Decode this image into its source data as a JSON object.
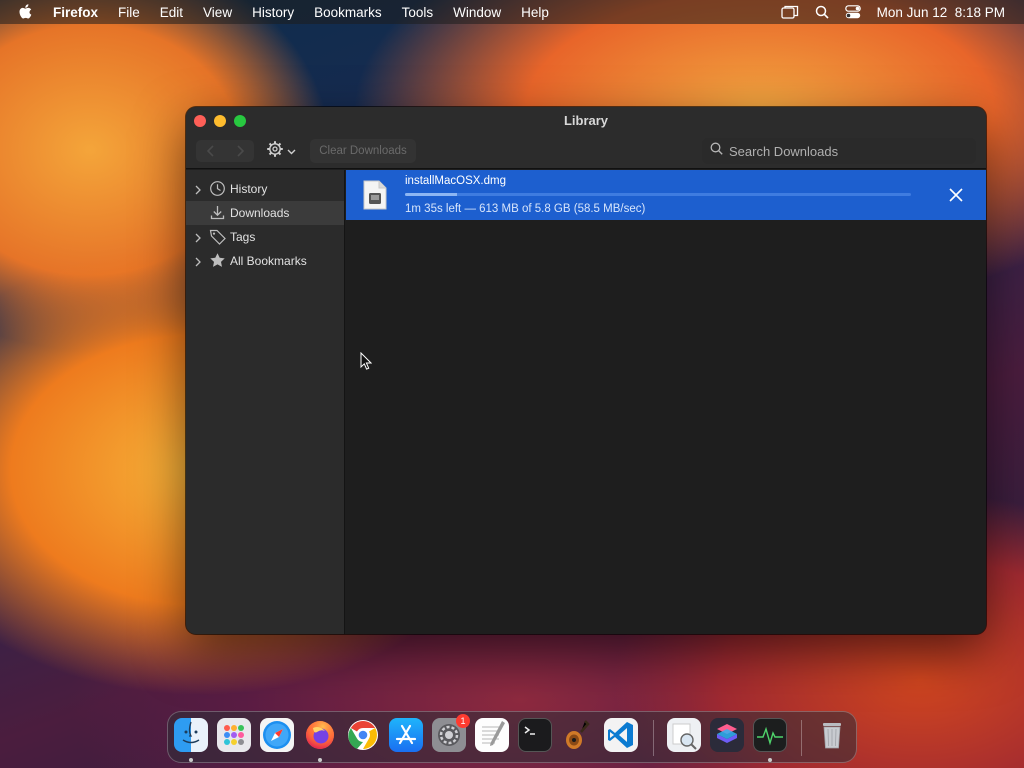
{
  "menubar": {
    "app_name": "Firefox",
    "menus": [
      "File",
      "Edit",
      "View",
      "History",
      "Bookmarks",
      "Tools",
      "Window",
      "Help"
    ],
    "clock": "Mon Jun 12  8:18 PM",
    "status_icons": [
      "screen-mirroring-icon",
      "spotlight-search-icon",
      "control-center-icon"
    ]
  },
  "window": {
    "title": "Library",
    "toolbar": {
      "clear_label": "Clear Downloads",
      "search_placeholder": "Search Downloads"
    },
    "sidebar": {
      "items": [
        {
          "label": "History",
          "icon": "clock-icon",
          "expandable": true
        },
        {
          "label": "Downloads",
          "icon": "download-icon",
          "expandable": false,
          "selected": true
        },
        {
          "label": "Tags",
          "icon": "tag-icon",
          "expandable": true
        },
        {
          "label": "All Bookmarks",
          "icon": "star-icon",
          "expandable": true
        }
      ]
    },
    "download": {
      "filename": "installMacOSX.dmg",
      "status": "1m 35s left — 613 MB of 5.8 GB (58.5 MB/sec)",
      "progress": 0.103
    }
  },
  "dock": {
    "apps": [
      "Finder",
      "Launchpad",
      "Safari",
      "Firefox",
      "Chrome",
      "App Store",
      "System Settings",
      "TextEdit",
      "Terminal",
      "GarageBand",
      "Visual Studio Code",
      "Preview",
      "Shortcuts",
      "Activity Monitor",
      "Trash"
    ],
    "settings_badge": "1"
  },
  "colors": {
    "selection_blue": "#1d5fcf",
    "close": "#fe5f57",
    "minimize": "#febc2e",
    "maximize": "#28c840"
  }
}
